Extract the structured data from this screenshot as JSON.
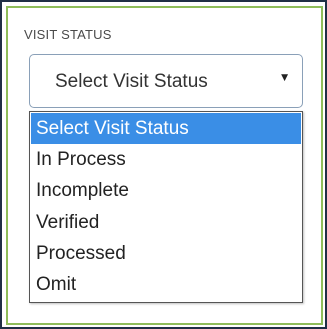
{
  "field": {
    "label": "VISIT STATUS",
    "selected_value": "Select Visit Status",
    "caret_icon": "▼"
  },
  "dropdown": {
    "options": [
      "Select Visit Status",
      "In Process",
      "Incomplete",
      "Verified",
      "Processed",
      "Omit"
    ],
    "highlighted_index": 0
  },
  "colors": {
    "outer_border": "#1f2f45",
    "panel_border": "#8fbd5a",
    "highlight": "#3a8ee6"
  }
}
